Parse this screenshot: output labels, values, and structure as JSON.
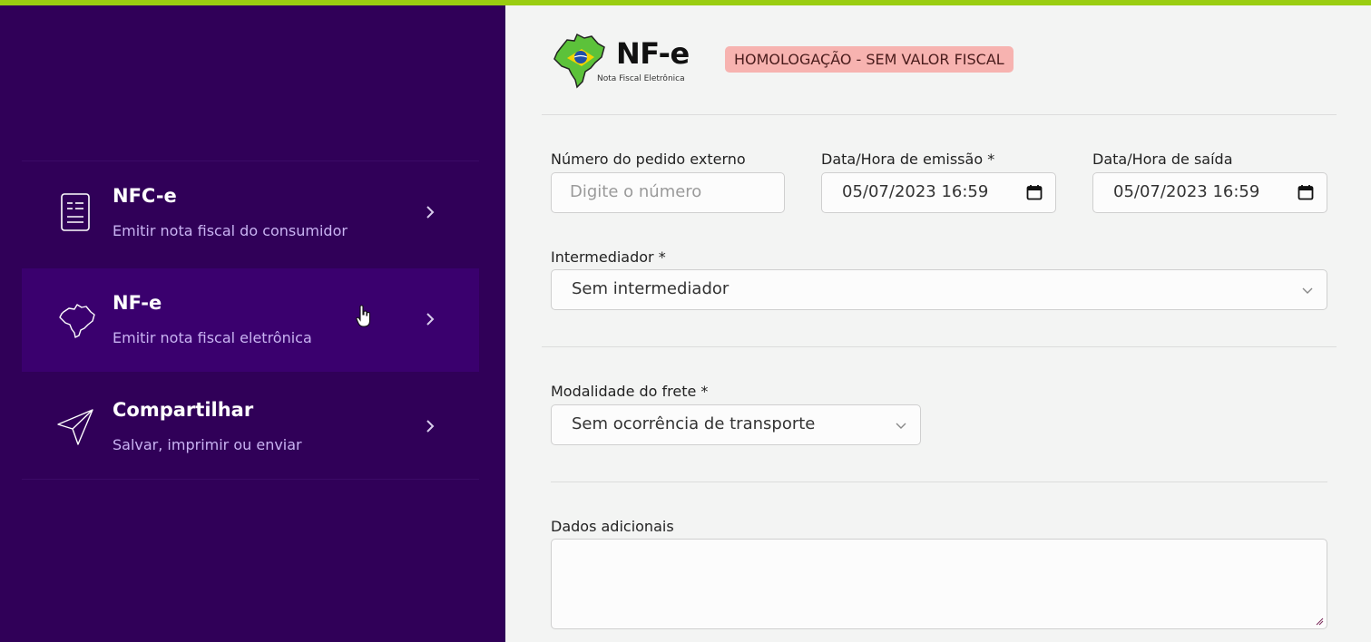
{
  "colors": {
    "accent_bar": "#9acd11",
    "sidebar_bg": "#300058",
    "sidebar_active": "#3a006e",
    "badge_bg": "#f7b3b0"
  },
  "sidebar": {
    "items": [
      {
        "title": "NFC-e",
        "subtitle": "Emitir nota fiscal do consumidor",
        "icon": "receipt-icon",
        "active": false
      },
      {
        "title": "NF-e",
        "subtitle": "Emitir nota fiscal eletrônica",
        "icon": "brazil-map-icon",
        "active": true
      },
      {
        "title": "Compartilhar",
        "subtitle": "Salvar, imprimir ou enviar",
        "icon": "paper-plane-icon",
        "active": false
      }
    ]
  },
  "header": {
    "logo_text": "NF-e",
    "logo_subtitle": "Nota Fiscal Eletrônica",
    "badge": "HOMOLOGAÇÃO - SEM VALOR FISCAL"
  },
  "form": {
    "pedido": {
      "label": "Número do pedido externo",
      "placeholder": "Digite o número"
    },
    "emissao": {
      "label": "Data/Hora de emissão *",
      "value": "05/07/2023 16:59"
    },
    "saida": {
      "label": "Data/Hora de saída",
      "value": "05/07/2023 16:59"
    },
    "intermediador": {
      "label": "Intermediador *",
      "value": "Sem intermediador"
    },
    "frete": {
      "label": "Modalidade do frete *",
      "value": "Sem ocorrência de transporte"
    },
    "adicionais": {
      "label": "Dados adicionais",
      "value": ""
    }
  }
}
